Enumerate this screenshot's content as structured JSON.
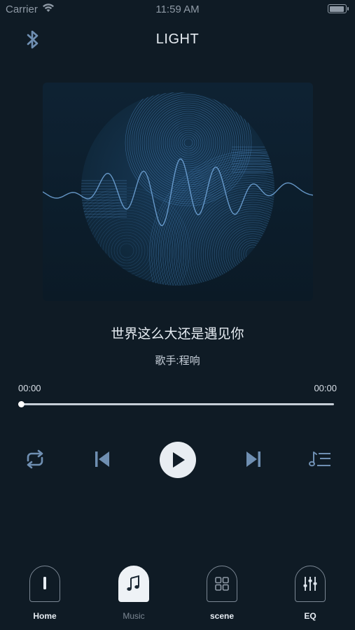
{
  "status_bar": {
    "carrier": "Carrier",
    "time": "11:59 AM"
  },
  "header": {
    "title": "LIGHT",
    "bluetooth_icon": "bluetooth-icon"
  },
  "artwork": {
    "description_icon": "album-art-waveform"
  },
  "track": {
    "title": "世界这么大还是遇见你",
    "artist": "歌手:程响"
  },
  "progress": {
    "current": "00:00",
    "total": "00:00",
    "fraction": 0
  },
  "controls": {
    "repeat_icon": "repeat-icon",
    "prev_icon": "skip-previous-icon",
    "play_icon": "play-icon",
    "next_icon": "skip-next-icon",
    "playlist_icon": "playlist-icon"
  },
  "tabs": [
    {
      "label": "Home",
      "icon": "light-bar-icon",
      "active": false
    },
    {
      "label": "Music",
      "icon": "music-note-icon",
      "active": true
    },
    {
      "label": "scene",
      "icon": "grid-icon",
      "active": false
    },
    {
      "label": "EQ",
      "icon": "equalizer-icon",
      "active": false
    }
  ],
  "colors": {
    "background": "#0f1b25",
    "accent": "#3f7fbd",
    "text": "#e7edf3"
  }
}
